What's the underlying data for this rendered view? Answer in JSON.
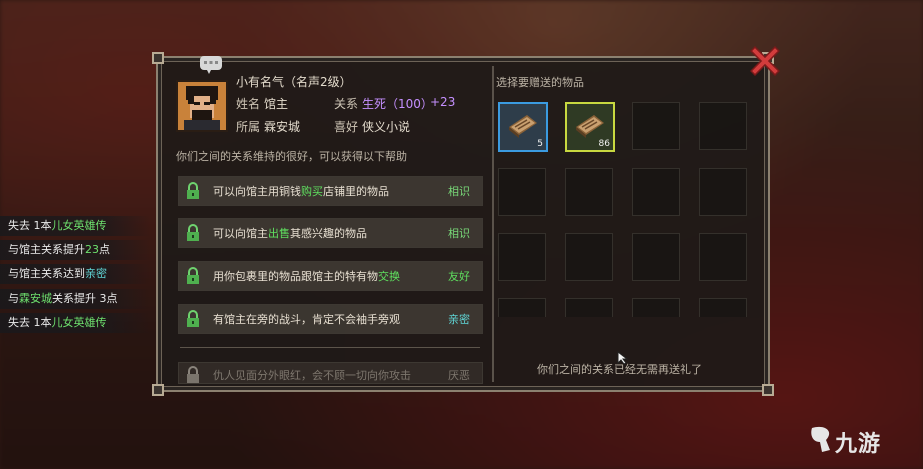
{
  "npc": {
    "fame_title": "小有名气（名声2级）",
    "name_label": "姓名",
    "name_value": "馆主",
    "relation_label": "关系",
    "relation_value": "生死（100）",
    "relation_delta": "+23",
    "affiliation_label": "所属",
    "affiliation_value": "霖安城",
    "hobby_label": "喜好",
    "hobby_value": "侠义小说",
    "relation_desc": "你们之间的关系维持的很好，可以获得以下帮助"
  },
  "benefits": [
    {
      "pre": "可以向馆主用铜钱",
      "hl": "购买",
      "post": "店铺里的物品",
      "level": "相识",
      "locked": false
    },
    {
      "pre": "可以向馆主",
      "hl": "出售",
      "post": "其感兴趣的物品",
      "level": "相识",
      "locked": false
    },
    {
      "pre": "用你包裹里的物品跟馆主的特有物",
      "hl": "交换",
      "post": "",
      "level": "友好",
      "locked": false
    },
    {
      "pre": "有馆主在旁的战斗，肯定不会袖手旁观",
      "hl": "",
      "post": "",
      "level": "亲密",
      "locked": false
    },
    {
      "pre": "仇人见面分外眼红，会不顾一切向你攻击",
      "hl": "",
      "post": "",
      "level": "厌恶",
      "locked": true
    }
  ],
  "gift": {
    "header": "选择要赠送的物品",
    "items": [
      {
        "count": "5"
      },
      {
        "count": "86"
      }
    ],
    "footer": "你们之间的关系已经无需再送礼了"
  },
  "log": [
    {
      "a": "失去 1本",
      "b": "儿女英雄传",
      "c": ""
    },
    {
      "a": "与馆主关系提升",
      "b": "23",
      "c": "点"
    },
    {
      "a": "与馆主关系达到",
      "b": "亲密",
      "c": ""
    },
    {
      "a": "与",
      "b": "霖安城",
      "c": "关系提升 3点"
    },
    {
      "a": "失去 1本",
      "b": "儿女英雄传",
      "c": ""
    }
  ],
  "watermark": "九游",
  "colors": {
    "highlight_green": "#5fe05f",
    "relation_purple": "#c590ff",
    "intimate_cyan": "#5fd4d4",
    "close_red": "#d23c3c"
  },
  "icons": [
    "close-icon",
    "lock-icon",
    "speech-bubble-icon",
    "book-icon",
    "cursor-icon",
    "watermark-logo-icon"
  ]
}
